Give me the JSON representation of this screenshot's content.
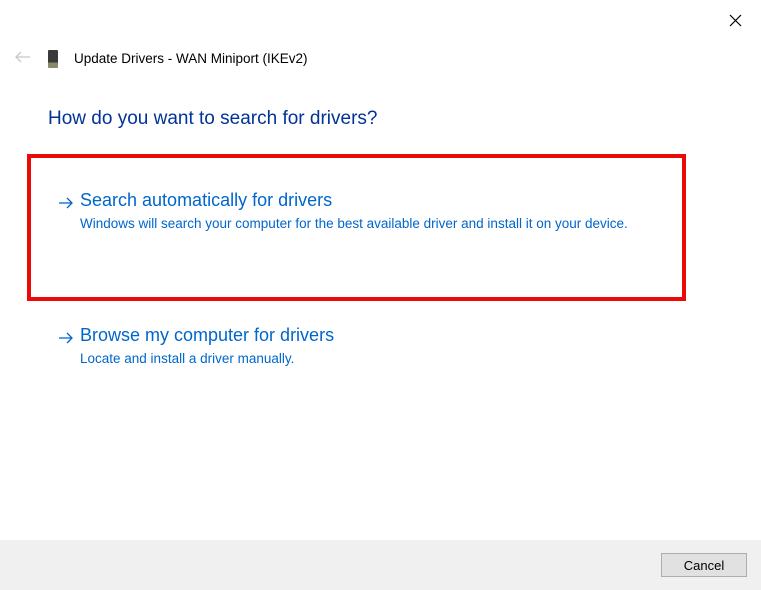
{
  "header": {
    "title": "Update Drivers - WAN Miniport (IKEv2)"
  },
  "heading": "How do you want to search for drivers?",
  "options": [
    {
      "title": "Search automatically for drivers",
      "description": "Windows will search your computer for the best available driver and install it on your device."
    },
    {
      "title": "Browse my computer for drivers",
      "description": "Locate and install a driver manually."
    }
  ],
  "footer": {
    "cancel_label": "Cancel"
  }
}
